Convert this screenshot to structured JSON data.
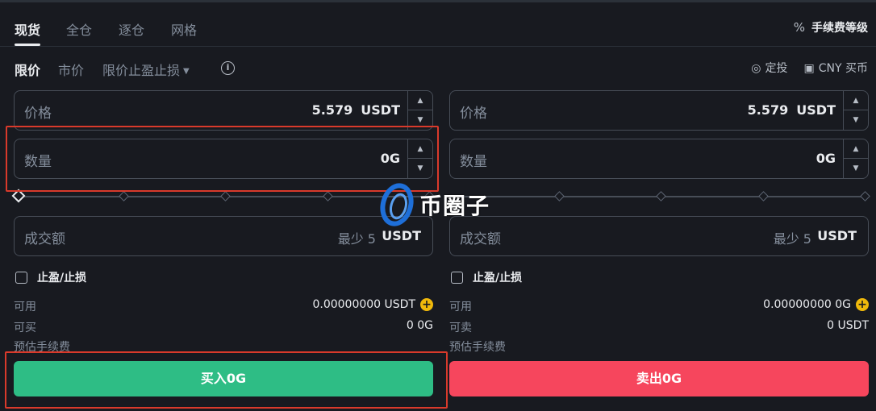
{
  "tabs": {
    "items": [
      "现货",
      "全仓",
      "逐仓",
      "网格"
    ],
    "fee_icon": "%",
    "fee_level": "手续费等级"
  },
  "order_types": {
    "limit": "限价",
    "market": "市价",
    "stop_limit": "限价止盈止损",
    "info_icon": "i",
    "auto_invest": "定投",
    "cny_buy": "CNY 买币"
  },
  "buy": {
    "price_label": "价格",
    "price_value": "5.579",
    "price_unit": "USDT",
    "qty_label": "数量",
    "qty_value": "0G",
    "total_label": "成交额",
    "total_min": "最少 5",
    "total_unit": "USDT",
    "tpsl_label": "止盈/止损",
    "avail_label": "可用",
    "avail_value": "0.00000000 USDT",
    "max_label": "可买",
    "max_value": "0 0G",
    "fee_label": "预估手续费",
    "action_label": "买入0G"
  },
  "sell": {
    "price_label": "价格",
    "price_value": "5.579",
    "price_unit": "USDT",
    "qty_label": "数量",
    "qty_value": "0G",
    "total_label": "成交额",
    "total_min": "最少 5",
    "total_unit": "USDT",
    "tpsl_label": "止盈/止损",
    "avail_label": "可用",
    "avail_value": "0.00000000 0G",
    "max_label": "可卖",
    "max_value": "0 USDT",
    "fee_label": "预估手续费",
    "action_label": "卖出0G"
  },
  "slider_level": 0,
  "watermark": {
    "text": "币圈子"
  },
  "colors": {
    "background": "#181a20",
    "buy": "#2ebd85",
    "sell": "#f6465d",
    "accent": "#f0b90b",
    "highlight": "#d93a2b"
  }
}
